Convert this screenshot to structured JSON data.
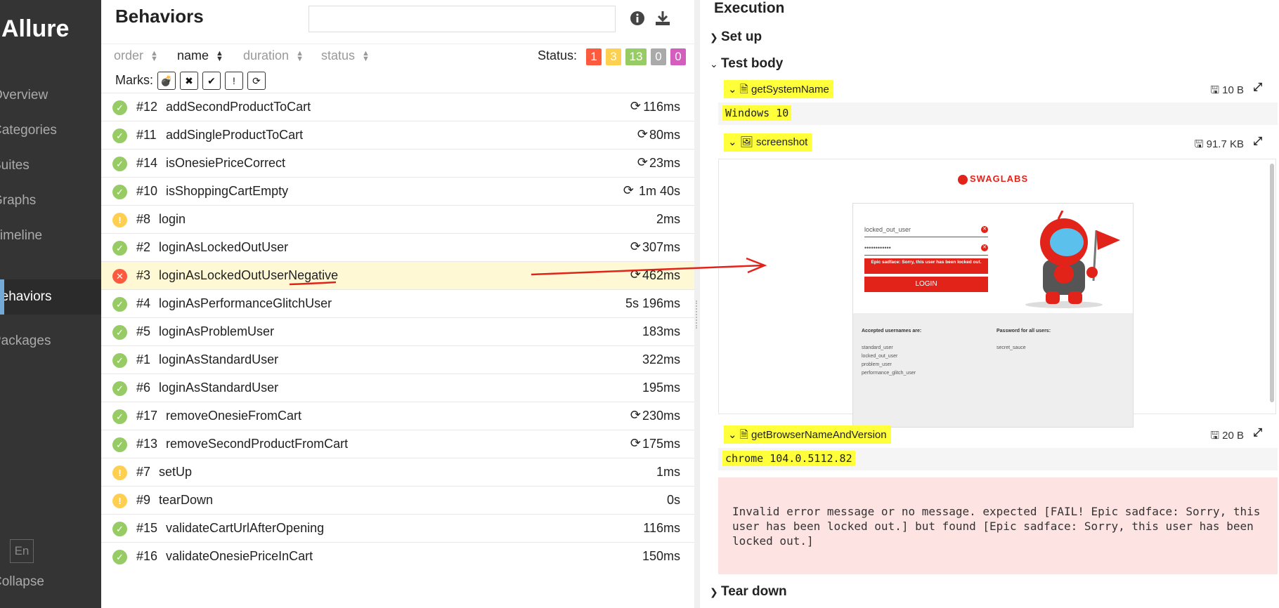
{
  "sidebar": {
    "brand": "Allure",
    "items": [
      {
        "label": "Overview",
        "active": false
      },
      {
        "label": "Categories",
        "active": false
      },
      {
        "label": "Suites",
        "active": false
      },
      {
        "label": "Graphs",
        "active": false
      },
      {
        "label": "Timeline",
        "active": false
      },
      {
        "label": "Behaviors",
        "active": true
      },
      {
        "label": "Packages",
        "active": false
      }
    ],
    "language": "En",
    "collapse": "Collapse"
  },
  "behaviors": {
    "title": "Behaviors",
    "search_placeholder": "",
    "icons": [
      "info-icon",
      "download-icon"
    ],
    "sort": [
      {
        "label": "order",
        "active": false
      },
      {
        "label": "name",
        "active": true
      },
      {
        "label": "duration",
        "active": false
      },
      {
        "label": "status",
        "active": false
      }
    ],
    "status_label": "Status:",
    "status_counts": [
      {
        "value": "1",
        "color": "#fd5a3e"
      },
      {
        "value": "3",
        "color": "#ffd050"
      },
      {
        "value": "13",
        "color": "#97cc64"
      },
      {
        "value": "0",
        "color": "#aaaaaa"
      },
      {
        "value": "0",
        "color": "#d35ebe"
      }
    ],
    "marks_label": "Marks:",
    "marks": [
      "flaky-icon",
      "new-failed-icon",
      "new-passed-icon",
      "new-broken-icon",
      "retries-icon"
    ],
    "rows": [
      {
        "status": "passed",
        "num": "#12",
        "name": "addSecondProductToCart",
        "retry": true,
        "duration": "116ms"
      },
      {
        "status": "passed",
        "num": "#11",
        "name": "addSingleProductToCart",
        "retry": true,
        "duration": "80ms"
      },
      {
        "status": "passed",
        "num": "#14",
        "name": "isOnesiePriceCorrect",
        "retry": true,
        "duration": "23ms"
      },
      {
        "status": "passed",
        "num": "#10",
        "name": "isShoppingCartEmpty",
        "retry": true,
        "duration": "1m 40s"
      },
      {
        "status": "broken",
        "num": "#8",
        "name": "login",
        "retry": false,
        "duration": "2ms"
      },
      {
        "status": "passed",
        "num": "#2",
        "name": "loginAsLockedOutUser",
        "retry": true,
        "duration": "307ms"
      },
      {
        "status": "failed",
        "num": "#3",
        "name": "loginAsLockedOutUserNegative",
        "retry": true,
        "duration": "462ms",
        "selected": true
      },
      {
        "status": "passed",
        "num": "#4",
        "name": "loginAsPerformanceGlitchUser",
        "retry": false,
        "duration": "5s 196ms"
      },
      {
        "status": "passed",
        "num": "#5",
        "name": "loginAsProblemUser",
        "retry": false,
        "duration": "183ms"
      },
      {
        "status": "passed",
        "num": "#1",
        "name": "loginAsStandardUser",
        "retry": false,
        "duration": "322ms"
      },
      {
        "status": "passed",
        "num": "#6",
        "name": "loginAsStandardUser",
        "retry": false,
        "duration": "195ms"
      },
      {
        "status": "passed",
        "num": "#17",
        "name": "removeOnesieFromCart",
        "retry": true,
        "duration": "230ms"
      },
      {
        "status": "passed",
        "num": "#13",
        "name": "removeSecondProductFromCart",
        "retry": true,
        "duration": "175ms"
      },
      {
        "status": "broken",
        "num": "#7",
        "name": "setUp",
        "retry": false,
        "duration": "1ms"
      },
      {
        "status": "broken",
        "num": "#9",
        "name": "tearDown",
        "retry": false,
        "duration": "0s"
      },
      {
        "status": "passed",
        "num": "#15",
        "name": "validateCartUrlAfterOpening",
        "retry": false,
        "duration": "116ms"
      },
      {
        "status": "passed",
        "num": "#16",
        "name": "validateOnesiePriceInCart",
        "retry": false,
        "duration": "150ms"
      }
    ]
  },
  "execution": {
    "title": "Execution",
    "setup": "Set up",
    "test_body": "Test body",
    "teardown": "Tear down",
    "attachments": [
      {
        "name": "getSystemName",
        "size": "10 B",
        "content": "Windows 10"
      },
      {
        "name": "screenshot",
        "size": "91.7 KB"
      },
      {
        "name": "getBrowserNameAndVersion",
        "size": "20 B",
        "content": "chrome 104.0.5112.82"
      }
    ],
    "error": "Invalid error message or no message. expected [FAIL! Epic sadface: Sorry, this user has been locked out.] but found [Epic sadface: Sorry, this user has been locked out.]"
  },
  "screenshot": {
    "logo": "SWAGLABS",
    "username": "locked_out_user",
    "password": "••••••••••••",
    "error": "Epic sadface: Sorry, this user has been locked out.",
    "login_button": "LOGIN",
    "accepted_title": "Accepted usernames are:",
    "usernames": [
      "standard_user",
      "locked_out_user",
      "problem_user",
      "performance_glitch_user"
    ],
    "password_title": "Password for all users:",
    "password_value": "secret_sauce"
  }
}
